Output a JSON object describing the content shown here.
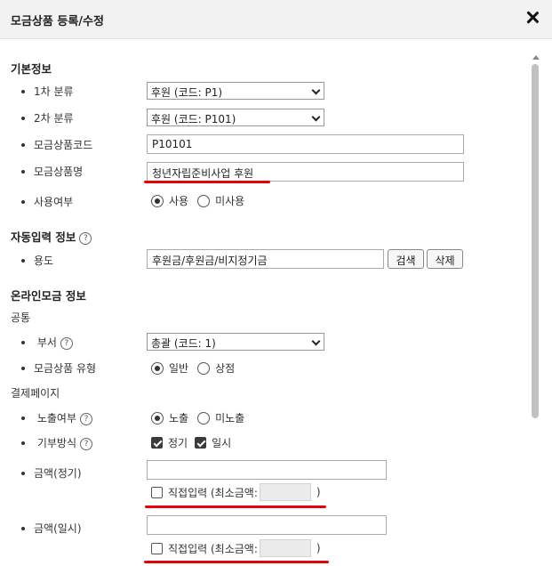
{
  "dialog": {
    "title": "모금상품 등록/수정"
  },
  "basic": {
    "title": "기본정보",
    "category1": {
      "label": "1차 분류",
      "value": "후원 (코드: P1)"
    },
    "category2": {
      "label": "2차 분류",
      "value": "후원 (코드: P101)"
    },
    "code": {
      "label": "모금상품코드",
      "value": "P10101"
    },
    "name": {
      "label": "모금상품명",
      "value": "청년자립준비사업 후원"
    },
    "use": {
      "label": "사용여부",
      "options": [
        "사용",
        "미사용"
      ],
      "selected": "사용"
    }
  },
  "auto": {
    "title": "자동입력 정보",
    "help": "?",
    "purpose": {
      "label": "용도",
      "value": "후원금/후원금/비지정기금"
    },
    "search_label": "검색",
    "delete_label": "삭제"
  },
  "online": {
    "title": "온라인모금 정보",
    "common_label": "공통",
    "dept": {
      "label": "부서",
      "help": "?",
      "value": "총괄 (코드: 1)"
    },
    "type": {
      "label": "모금상품 유형",
      "options": [
        "일반",
        "상점"
      ],
      "selected": "일반"
    },
    "payment_label": "결제페이지",
    "display": {
      "label": "노출여부",
      "help": "?",
      "options": [
        "노출",
        "미노출"
      ],
      "selected": "노출"
    },
    "method": {
      "label": "기부방식",
      "help": "?",
      "options": [
        "정기",
        "일시"
      ],
      "checked": [
        true,
        true
      ]
    },
    "amount_regular": {
      "label": "금액(정기)",
      "value": "",
      "direct_text": "직접입력 (최소금액:",
      "close_paren": ")"
    },
    "amount_once": {
      "label": "금액(일시)",
      "value": "",
      "direct_text": "직접입력 (최소금액:",
      "close_paren": ")"
    }
  },
  "colors": {
    "highlight": "#e8000a",
    "header_bg": "#f2f2f2"
  }
}
